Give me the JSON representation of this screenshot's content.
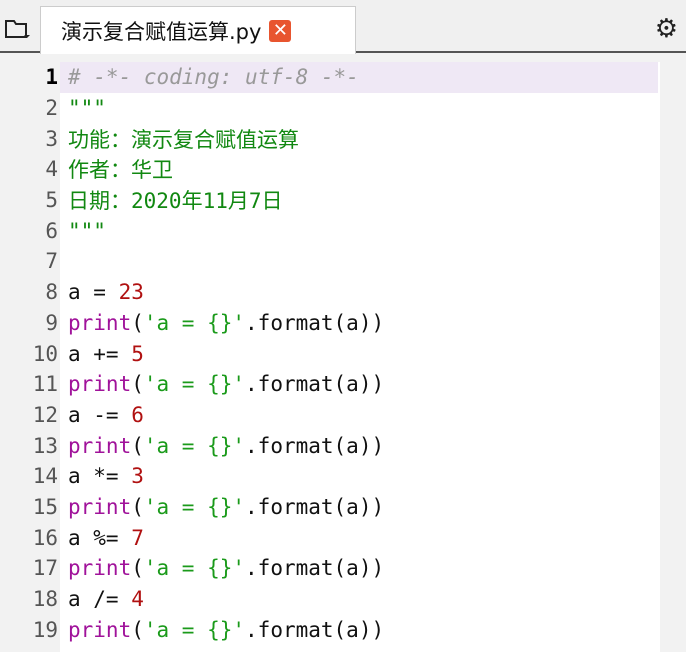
{
  "tab": {
    "title": "演示复合赋值运算.py",
    "close_icon": "close-icon"
  },
  "icons": {
    "folder": "folder-icon",
    "settings": "gear-icon"
  },
  "active_line": 1,
  "lines": [
    {
      "n": "1",
      "t": [
        [
          "cmt",
          "# -*- coding: utf-8 -*-"
        ]
      ]
    },
    {
      "n": "2",
      "t": [
        [
          "doc",
          "\"\"\""
        ]
      ]
    },
    {
      "n": "3",
      "t": [
        [
          "doc",
          "功能：演示复合赋值运算"
        ]
      ]
    },
    {
      "n": "4",
      "t": [
        [
          "doc",
          "作者：华卫"
        ]
      ]
    },
    {
      "n": "5",
      "t": [
        [
          "doc",
          "日期：2020年11月7日"
        ]
      ]
    },
    {
      "n": "6",
      "t": [
        [
          "doc",
          "\"\"\""
        ]
      ]
    },
    {
      "n": "7",
      "t": []
    },
    {
      "n": "8",
      "t": [
        [
          "plain",
          "a = "
        ],
        [
          "num-lit",
          "23"
        ]
      ]
    },
    {
      "n": "9",
      "t": [
        [
          "kw",
          "print"
        ],
        [
          "plain",
          "("
        ],
        [
          "str",
          "'a = {}'"
        ],
        [
          "plain",
          ".format(a))"
        ]
      ]
    },
    {
      "n": "10",
      "t": [
        [
          "plain",
          "a += "
        ],
        [
          "num-lit",
          "5"
        ]
      ]
    },
    {
      "n": "11",
      "t": [
        [
          "kw",
          "print"
        ],
        [
          "plain",
          "("
        ],
        [
          "str",
          "'a = {}'"
        ],
        [
          "plain",
          ".format(a))"
        ]
      ]
    },
    {
      "n": "12",
      "t": [
        [
          "plain",
          "a -= "
        ],
        [
          "num-lit",
          "6"
        ]
      ]
    },
    {
      "n": "13",
      "t": [
        [
          "kw",
          "print"
        ],
        [
          "plain",
          "("
        ],
        [
          "str",
          "'a = {}'"
        ],
        [
          "plain",
          ".format(a))"
        ]
      ]
    },
    {
      "n": "14",
      "t": [
        [
          "plain",
          "a *= "
        ],
        [
          "num-lit",
          "3"
        ]
      ]
    },
    {
      "n": "15",
      "t": [
        [
          "kw",
          "print"
        ],
        [
          "plain",
          "("
        ],
        [
          "str",
          "'a = {}'"
        ],
        [
          "plain",
          ".format(a))"
        ]
      ]
    },
    {
      "n": "16",
      "t": [
        [
          "plain",
          "a %= "
        ],
        [
          "num-lit",
          "7"
        ]
      ]
    },
    {
      "n": "17",
      "t": [
        [
          "kw",
          "print"
        ],
        [
          "plain",
          "("
        ],
        [
          "str",
          "'a = {}'"
        ],
        [
          "plain",
          ".format(a))"
        ]
      ]
    },
    {
      "n": "18",
      "t": [
        [
          "plain",
          "a /= "
        ],
        [
          "num-lit",
          "4"
        ]
      ]
    },
    {
      "n": "19",
      "t": [
        [
          "kw",
          "print"
        ],
        [
          "plain",
          "("
        ],
        [
          "str",
          "'a = {}'"
        ],
        [
          "plain",
          ".format(a))"
        ]
      ]
    }
  ]
}
